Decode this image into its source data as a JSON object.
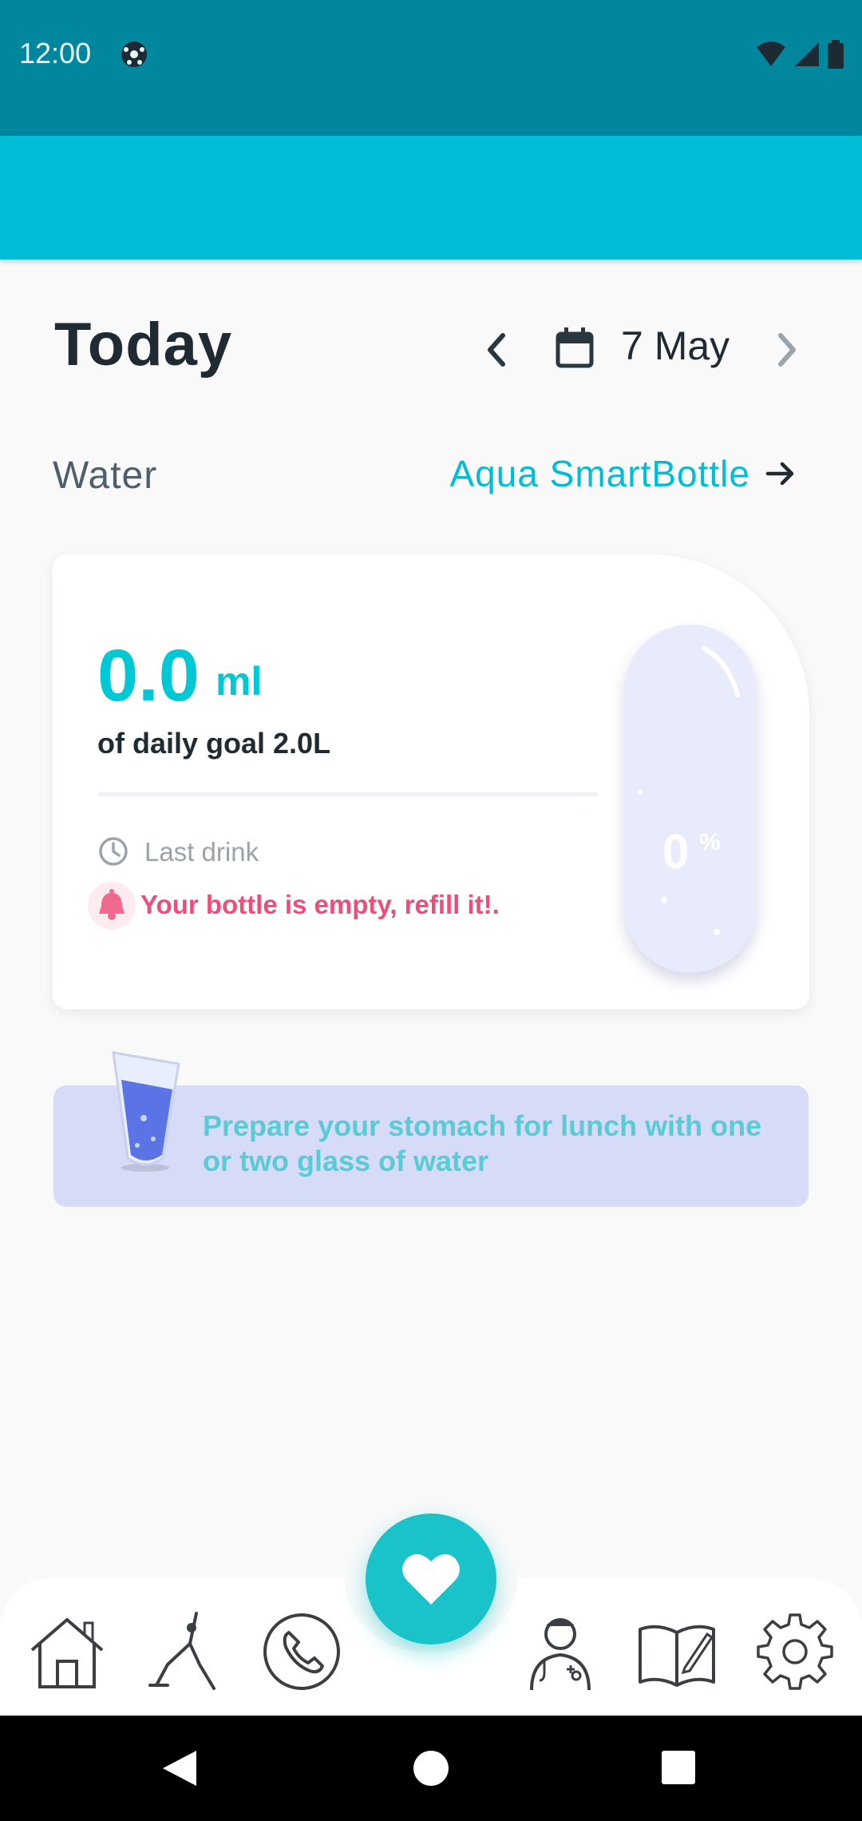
{
  "status_bar": {
    "time": "12:00"
  },
  "header": {
    "title": "Today",
    "date": "7 May"
  },
  "water": {
    "section_label": "Water",
    "device_link": "Aqua SmartBottle",
    "amount": "0.0",
    "unit": "ml",
    "goal_text": "of daily goal 2.0L",
    "last_drink_label": "Last drink",
    "alert": "Your bottle is empty, refill it!.",
    "bottle_percent": "0",
    "bottle_percent_sign": "%",
    "fill_fraction": 0
  },
  "tip": {
    "text": "Prepare your stomach for lunch with one or two glass of water"
  },
  "bottom_nav": {
    "items": [
      "home-icon",
      "yoga-icon",
      "phone-icon",
      "heart-icon",
      "doctor-icon",
      "journal-icon",
      "settings-icon"
    ]
  },
  "colors": {
    "accent": "#00bcd4",
    "status_bar": "#00879e",
    "alert": "#ec4e79",
    "bottle": "#e8ebfc",
    "tip_background": "#d6dcf7"
  }
}
